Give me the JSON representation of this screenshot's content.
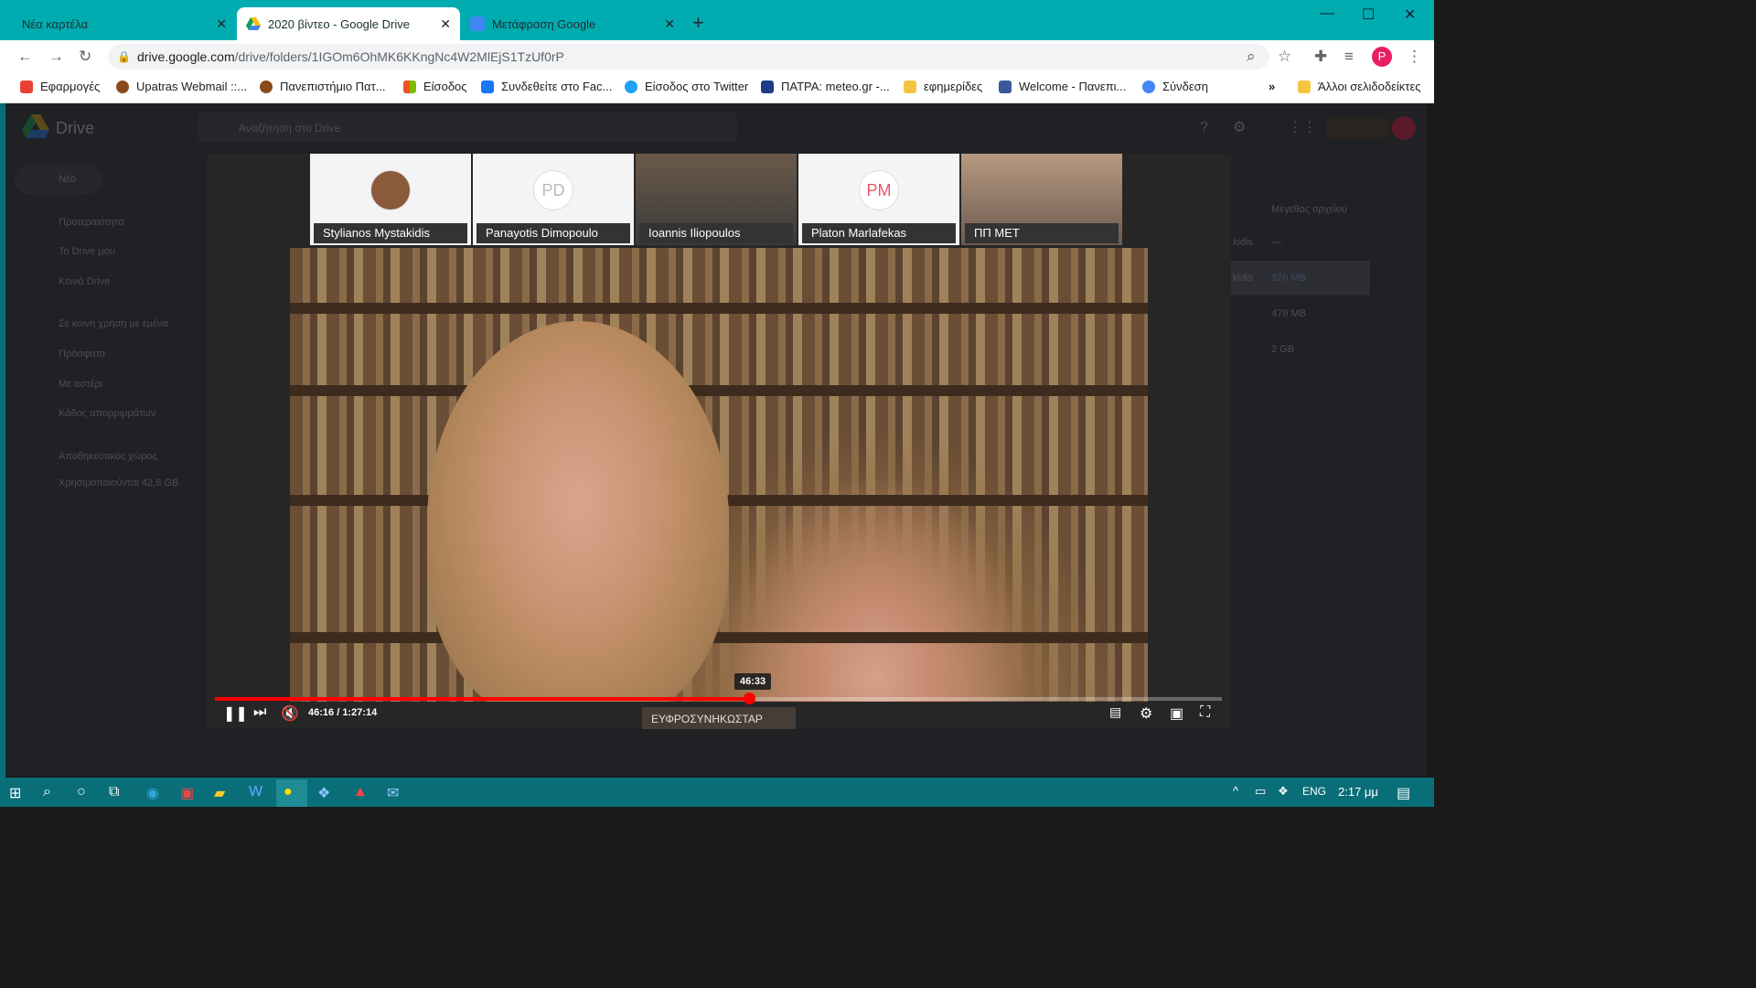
{
  "tabs": [
    {
      "title": "Νέα καρτέλα",
      "active": false
    },
    {
      "title": "2020 βίντεο - Google Drive",
      "active": true
    },
    {
      "title": "Μετάφραση Google",
      "active": false
    }
  ],
  "address": {
    "domain": "drive.google.com",
    "path": "/drive/folders/1IGOm6OhMK6KKngNc4W2MlEjS1TzUf0rP"
  },
  "profile_initial": "P",
  "bookmarks": [
    {
      "label": "Εφαρμογές",
      "color": "#e94235"
    },
    {
      "label": "Upatras Webmail ::...",
      "color": "#8b4a1e"
    },
    {
      "label": "Πανεπιστήμιο Πατ...",
      "color": "#8b4a1e"
    },
    {
      "label": "Είσοδος",
      "color": "#f25022"
    },
    {
      "label": "Συνδεθείτε στο Fac...",
      "color": "#1877f2"
    },
    {
      "label": "Είσοδος στο Twitter",
      "color": "#1da1f2"
    },
    {
      "label": "ΠΑΤΡΑ: meteo.gr -...",
      "color": "#1f3c88"
    },
    {
      "label": "εφημερίδες",
      "color": "#f5c542"
    },
    {
      "label": "Welcome - Πανεπι...",
      "color": "#3b5998"
    },
    {
      "label": "Σύνδεση",
      "color": "#4285f4"
    }
  ],
  "bookmarks_more": "»",
  "other_bookmarks": "Άλλοι σελιδοδείκτες",
  "drive": {
    "logo": "Drive",
    "search_placeholder": "Αναζήτηση στο Drive",
    "new_button": "Νέο",
    "nav": [
      "Προτεραιότητα",
      "Το Drive μου",
      "Κοινά Drive",
      "Σε κοινή χρήση με εμένα",
      "Πρόσφατα",
      "Με αστέρι",
      "Κάδος απορριμμάτων",
      "Αποθηκευτικός χώρος"
    ],
    "storage_used": "Χρησιμοποιούνται 42,8 GB",
    "col_header": "Μέγεθος αρχείου",
    "owner_fragment": "kidis",
    "sizes": [
      "—",
      "376 MB",
      "479 MB",
      "2 GB"
    ]
  },
  "participants": [
    {
      "name": "Stylianos Mystakidis",
      "initials": ""
    },
    {
      "name": "Panayotis Dimopoulo",
      "initials": "PD"
    },
    {
      "name": "Ioannis Iliopoulos",
      "initials": ""
    },
    {
      "name": "Platon Marlafekas",
      "initials": "PM"
    },
    {
      "name": "ΠΠ ΜΕΤ",
      "initials": ""
    }
  ],
  "player": {
    "tooltip_time": "46:33",
    "time_current": "46:16",
    "time_total": "1:27:14",
    "speaker_banner": "ΕΥΦΡΟΣΥΝΗΚΩΣΤΑΡ",
    "progress_fraction": 0.53
  },
  "taskbar": {
    "lang": "ENG",
    "clock": "2:17 μμ"
  },
  "colors": {
    "chrome_accent": "#01acb0",
    "progress": "#ff0000",
    "profile": "#e91e63"
  }
}
